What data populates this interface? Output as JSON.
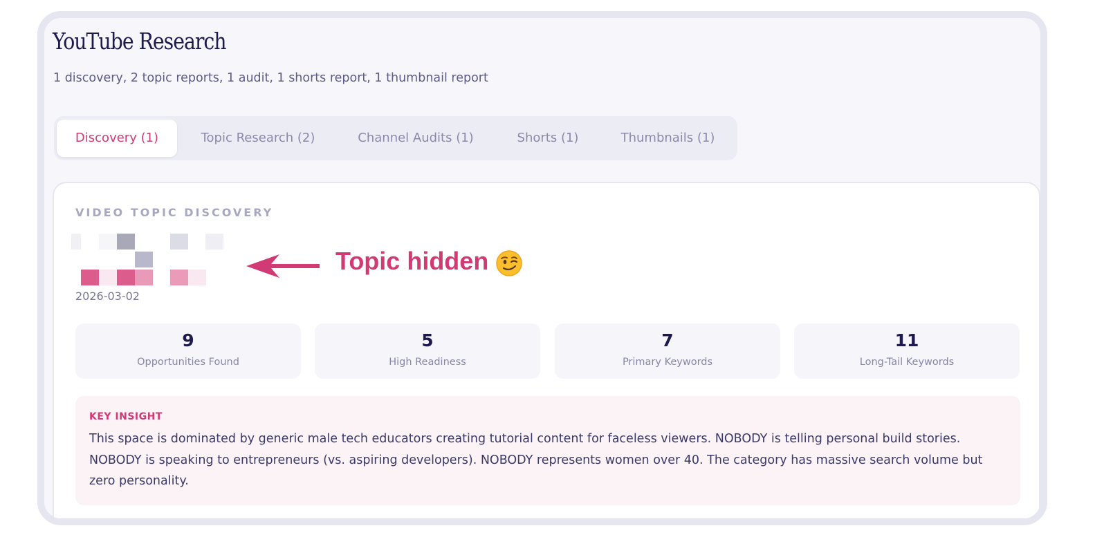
{
  "header": {
    "title": "YouTube Research",
    "subtitle": "1 discovery, 2 topic reports, 1 audit, 1 shorts report, 1 thumbnail report"
  },
  "tabs": [
    {
      "label": "Discovery (1)",
      "active": true
    },
    {
      "label": "Topic Research (2)",
      "active": false
    },
    {
      "label": "Channel Audits (1)",
      "active": false
    },
    {
      "label": "Shorts (1)",
      "active": false
    },
    {
      "label": "Thumbnails (1)",
      "active": false
    }
  ],
  "card": {
    "eyebrow": "VIDEO TOPIC DISCOVERY",
    "annotation": "Topic hidden",
    "annotation_emoji_icon": "winking-face-icon",
    "date": "2026-03-02",
    "stats": [
      {
        "value": "9",
        "label": "Opportunities Found"
      },
      {
        "value": "5",
        "label": "High Readiness"
      },
      {
        "value": "7",
        "label": "Primary Keywords"
      },
      {
        "value": "11",
        "label": "Long-Tail Keywords"
      }
    ],
    "insight": {
      "label": "KEY INSIGHT",
      "text": "This space is dominated by generic male tech educators creating tutorial content for faceless viewers. NOBODY is telling personal build stories. NOBODY is speaking to entrepreneurs (vs. aspiring developers). NOBODY represents women over 40. The category has massive search volume but zero personality."
    }
  },
  "colors": {
    "accent": "#d23a74",
    "title": "#1d1a4e",
    "muted": "#8b89a9",
    "frame": "#e6e6f0",
    "background": "#f6f6fb",
    "insight_bg": "#fbf3f6"
  }
}
